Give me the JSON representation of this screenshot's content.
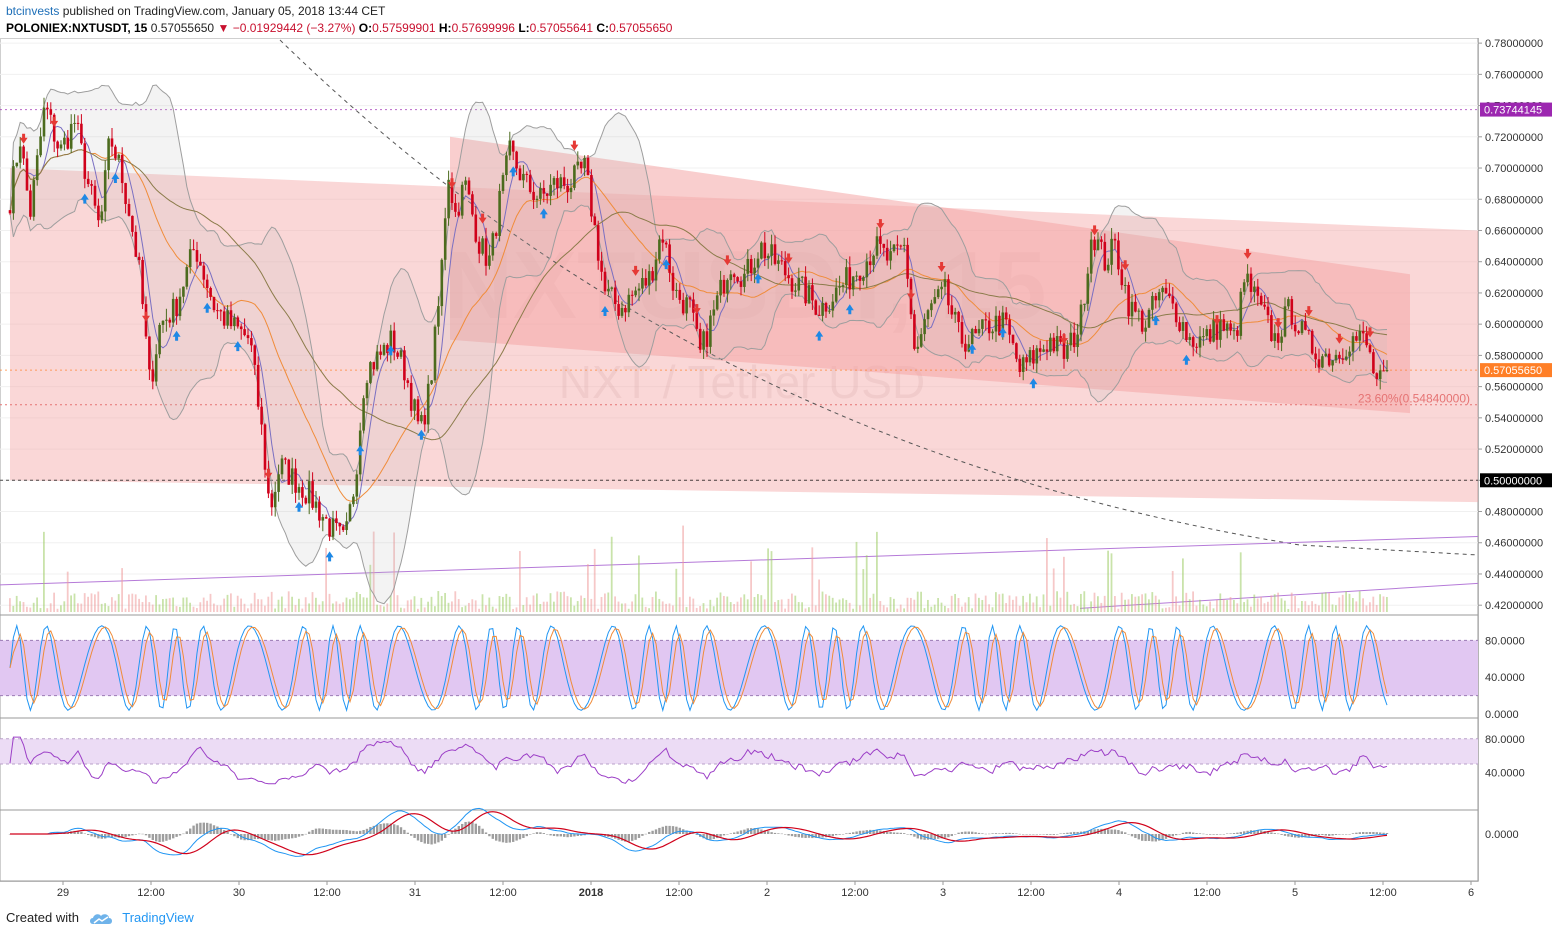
{
  "header": {
    "author": "btcinvests",
    "published_text": "published on TradingView.com, January 05, 2018 13:44 CET",
    "ticker": "POLONIEX:NXTUSDT, 15",
    "last_price": "0.57055650",
    "change": "−0.01929442 (−3.27%)",
    "o_label": "O:",
    "o_value": "0.57599901",
    "h_label": "H:",
    "h_value": "0.57699996",
    "l_label": "L:",
    "l_value": "0.57055641",
    "c_label": "C:",
    "c_value": "0.57055650"
  },
  "watermark": {
    "symbol": "NXTUSDT, 15",
    "name": "NXT / Tether USD"
  },
  "footer": {
    "created_with": "Created with",
    "brand": "TradingView"
  },
  "colors": {
    "up_candle": "#4c6b1e",
    "down_candle": "#d0021b",
    "channel_fill": "#f4a6a6",
    "bollinger": "#9e9e9e",
    "ma_fast": "#7a6fc2",
    "ma_mid": "#f08c3a",
    "ma_slow": "#8b7b4a",
    "stoch_k": "#2196f3",
    "stoch_d": "#f08c3a",
    "rsi": "#9c3fc7",
    "macd": "#2196f3",
    "signal": "#d0021b",
    "label_purple": "#9c27b0",
    "label_orange": "#ff7f27",
    "label_black": "#000000"
  },
  "chart_data": [
    {
      "panel": "price",
      "type": "candlestick",
      "y_scale": "linear",
      "ylim": [
        0.415,
        0.782
      ],
      "y_ticks": [
        "0.78000000",
        "0.76000000",
        "0.74000000",
        "0.72000000",
        "0.70000000",
        "0.68000000",
        "0.66000000",
        "0.64000000",
        "0.62000000",
        "0.60000000",
        "0.58000000",
        "0.56000000",
        "0.54000000",
        "0.52000000",
        "0.50000000",
        "0.48000000",
        "0.46000000",
        "0.44000000",
        "0.42000000"
      ],
      "x_labels": [
        "29",
        "12:00",
        "30",
        "12:00",
        "31",
        "12:00",
        "2018",
        "12:00",
        "2",
        "12:00",
        "3",
        "12:00",
        "4",
        "12:00",
        "5",
        "12:00",
        "6"
      ],
      "price_labels": [
        {
          "text": "0.73744145",
          "value": 0.73744145,
          "color": "#9c27b0"
        },
        {
          "text": "0.57055650",
          "value": 0.5705565,
          "color": "#ff7f27"
        },
        {
          "text": "0.50000000",
          "value": 0.5,
          "color": "#000000"
        }
      ],
      "fib_label": "23.60%(0.54840000)",
      "fib_value": 0.5484,
      "close_path": [
        [
          0,
          0.7
        ],
        [
          10,
          0.68
        ],
        [
          20,
          0.72
        ],
        [
          30,
          0.67
        ],
        [
          45,
          0.74
        ],
        [
          60,
          0.71
        ],
        [
          75,
          0.73
        ],
        [
          88,
          0.69
        ],
        [
          100,
          0.66
        ],
        [
          110,
          0.72
        ],
        [
          120,
          0.7
        ],
        [
          130,
          0.67
        ],
        [
          140,
          0.63
        ],
        [
          150,
          0.56
        ],
        [
          160,
          0.6
        ],
        [
          175,
          0.61
        ],
        [
          195,
          0.65
        ],
        [
          205,
          0.63
        ],
        [
          215,
          0.61
        ],
        [
          230,
          0.6
        ],
        [
          250,
          0.59
        ],
        [
          262,
          0.53
        ],
        [
          270,
          0.48
        ],
        [
          280,
          0.51
        ],
        [
          295,
          0.5
        ],
        [
          310,
          0.49
        ],
        [
          330,
          0.47
        ],
        [
          345,
          0.46
        ],
        [
          355,
          0.5
        ],
        [
          365,
          0.57
        ],
        [
          380,
          0.58
        ],
        [
          392,
          0.59
        ],
        [
          405,
          0.57
        ],
        [
          420,
          0.53
        ],
        [
          430,
          0.56
        ],
        [
          440,
          0.62
        ],
        [
          448,
          0.7
        ],
        [
          455,
          0.67
        ],
        [
          465,
          0.69
        ],
        [
          480,
          0.65
        ],
        [
          490,
          0.64
        ],
        [
          500,
          0.68
        ],
        [
          510,
          0.71
        ],
        [
          525,
          0.69
        ],
        [
          540,
          0.68
        ],
        [
          555,
          0.69
        ],
        [
          570,
          0.69
        ],
        [
          585,
          0.7
        ],
        [
          595,
          0.66
        ],
        [
          605,
          0.62
        ],
        [
          620,
          0.61
        ],
        [
          635,
          0.62
        ],
        [
          650,
          0.63
        ],
        [
          662,
          0.66
        ],
        [
          675,
          0.62
        ],
        [
          690,
          0.61
        ],
        [
          700,
          0.58
        ],
        [
          715,
          0.61
        ],
        [
          730,
          0.64
        ],
        [
          745,
          0.63
        ],
        [
          760,
          0.65
        ],
        [
          775,
          0.64
        ],
        [
          790,
          0.63
        ],
        [
          805,
          0.62
        ],
        [
          820,
          0.61
        ],
        [
          835,
          0.62
        ],
        [
          850,
          0.63
        ],
        [
          865,
          0.64
        ],
        [
          875,
          0.65
        ],
        [
          890,
          0.64
        ],
        [
          905,
          0.65
        ],
        [
          915,
          0.58
        ],
        [
          930,
          0.61
        ],
        [
          945,
          0.62
        ],
        [
          960,
          0.59
        ],
        [
          975,
          0.59
        ],
        [
          990,
          0.6
        ],
        [
          1005,
          0.6
        ],
        [
          1020,
          0.57
        ],
        [
          1035,
          0.58
        ],
        [
          1050,
          0.59
        ],
        [
          1065,
          0.58
        ],
        [
          1080,
          0.6
        ],
        [
          1092,
          0.66
        ],
        [
          1105,
          0.64
        ],
        [
          1115,
          0.65
        ],
        [
          1130,
          0.61
        ],
        [
          1145,
          0.6
        ],
        [
          1160,
          0.62
        ],
        [
          1175,
          0.61
        ],
        [
          1190,
          0.59
        ],
        [
          1205,
          0.59
        ],
        [
          1220,
          0.6
        ],
        [
          1235,
          0.59
        ],
        [
          1245,
          0.63
        ],
        [
          1260,
          0.61
        ],
        [
          1275,
          0.59
        ],
        [
          1290,
          0.61
        ],
        [
          1305,
          0.59
        ],
        [
          1320,
          0.58
        ],
        [
          1335,
          0.58
        ],
        [
          1350,
          0.59
        ],
        [
          1365,
          0.59
        ],
        [
          1378,
          0.56
        ],
        [
          1390,
          0.571
        ]
      ],
      "descending_channels": [
        {
          "upper": [
            [
              10,
              0.7
            ],
            [
              1478,
              0.66
            ]
          ],
          "lower": [
            [
              10,
              0.5
            ],
            [
              1478,
              0.486
            ]
          ]
        },
        {
          "upper": [
            [
              450,
              0.72
            ],
            [
              1410,
              0.632
            ]
          ],
          "lower": [
            [
              450,
              0.59
            ],
            [
              1410,
              0.543
            ]
          ]
        }
      ]
    },
    {
      "panel": "stochastic",
      "type": "line",
      "ylim": [
        0,
        100
      ],
      "y_ticks": [
        "80.0000",
        "40.0000",
        "0.0000"
      ],
      "band": [
        20,
        80
      ]
    },
    {
      "panel": "rsi",
      "type": "line",
      "ylim": [
        0,
        100
      ],
      "y_ticks": [
        "80.0000",
        "40.0000"
      ],
      "band": [
        50,
        80
      ]
    },
    {
      "panel": "macd",
      "type": "line",
      "y_ticks": [
        "0.0000"
      ]
    }
  ]
}
